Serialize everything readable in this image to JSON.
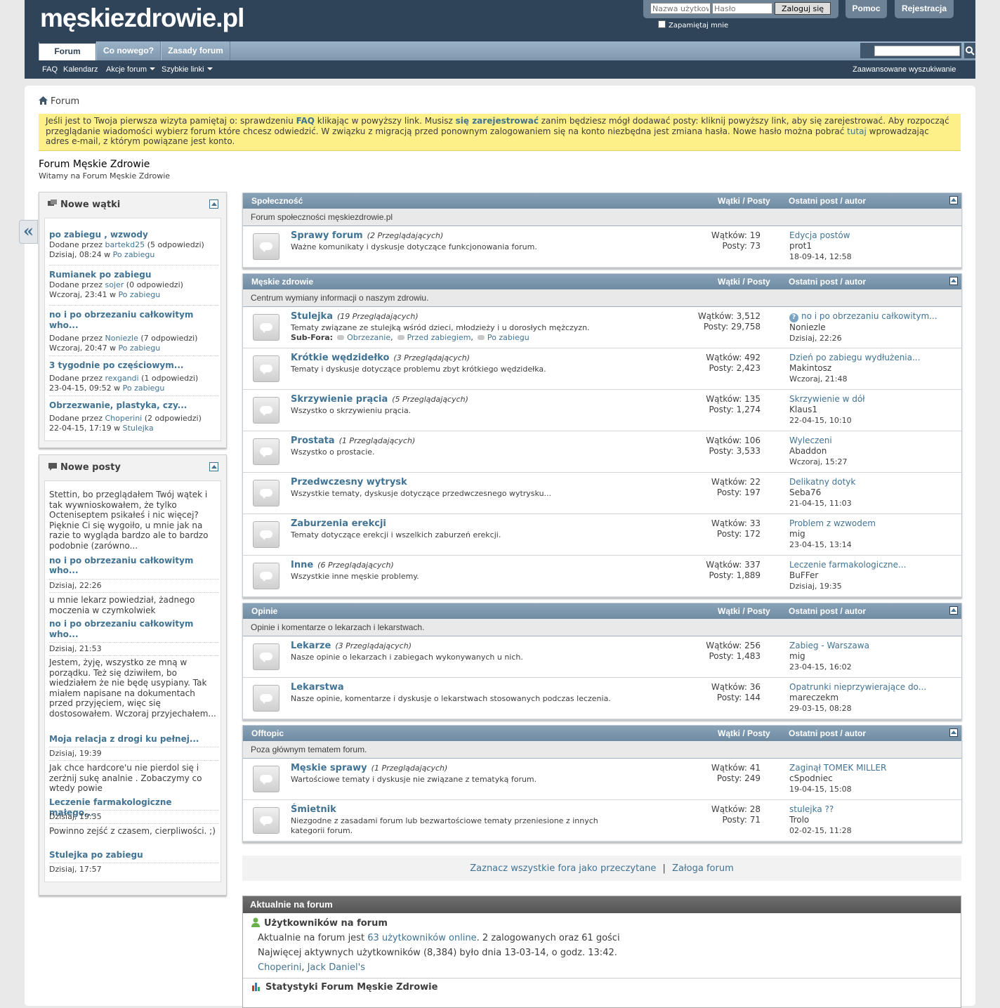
{
  "header": {
    "logo": "męskiezdrowie.pl",
    "username_placeholder": "Nazwa użytkownika",
    "password_placeholder": "Hasło",
    "login_button": "Zaloguj się",
    "remember_me": "Zapamiętaj mnie",
    "help": "Pomoc",
    "register": "Rejestracja"
  },
  "nav": {
    "tabs": [
      "Forum",
      "Co nowego?",
      "Zasady forum"
    ],
    "subnav": [
      "FAQ",
      "Kalendarz",
      "Akcje forum",
      "Szybkie linki"
    ],
    "advanced_search": "Zaawansowane wyszukiwanie"
  },
  "breadcrumb": "Forum",
  "notice": {
    "p1": "Jeśli jest to Twoja pierwsza wizyta pamiętaj o: sprawdzeniu ",
    "faq": "FAQ",
    "p2": " klikając w powyższy link. Musisz ",
    "register": "się zarejestrować",
    "p3": " zanim będziesz mógł dodawać posty: kliknij powyższy link, aby się zarejestrować. Aby rozpocząć przeglądanie wiadomości wybierz forum które chcesz odwiedzić. W związku z migracją przed ponownym zalogowaniem się na konto niezbędna jest zmiana hasła. Nowe hasło można pobrać ",
    "here": "tutaj",
    "p4": " wprowadzając adres e-mail, z którym powiązane jest konto."
  },
  "forum_title": "Forum Męskie Zdrowie",
  "forum_subtitle": "Witamy na Forum Męskie Zdrowie",
  "sidebar": {
    "new_threads_title": "Nowe wątki",
    "new_threads": [
      {
        "title": "po zabiegu , wzwody",
        "by": "Dodane przez ",
        "user": "bartekd25",
        "replies": " (5 odpowiedzi)",
        "date": "Dzisiaj, 08:24 w ",
        "forum": "Po zabiegu"
      },
      {
        "title": "Rumianek po zabiegu",
        "by": "Dodane przez ",
        "user": "sojer",
        "replies": " (0 odpowiedzi)",
        "date": "Wczoraj, 23:41 w ",
        "forum": "Po zabiegu"
      },
      {
        "title": "no i po obrzezaniu całkowitym who...",
        "by": "Dodane przez ",
        "user": "Noniezle",
        "replies": " (7 odpowiedzi)",
        "date": "Wczoraj, 20:47 w ",
        "forum": "Po zabiegu"
      },
      {
        "title": "3 tygodnie po częściowym...",
        "by": "Dodane przez ",
        "user": "rexgandi",
        "replies": " (1 odpowiedzi)",
        "date": "23-04-15, 09:52 w ",
        "forum": "Po zabiegu"
      },
      {
        "title": "Obrzezwanie, plastyka, czy...",
        "by": "Dodane przez ",
        "user": "Choperini",
        "replies": " (2 odpowiedzi)",
        "date": "22-04-15, 17:19 w ",
        "forum": "Stulejka"
      }
    ],
    "new_posts_title": "Nowe posty",
    "new_posts": [
      {
        "snippet": "Stettin, bo przeglądałem Twój wątek i tak wywnioskowałem, że tylko Octeniseptem psikałeś i nic więcej? Pięknie Ci się wygoiło, u mnie jak na razie to wygląda bardzo ale to bardzo podobnie (zarówno...",
        "title": "no i po obrzezaniu całkowitym who...",
        "date": "Dzisiaj, 22:26"
      },
      {
        "snippet": "u mnie lekarz powiedział, żadnego moczenia w czymkolwiek",
        "title": "no i po obrzezaniu całkowitym who...",
        "date": "Dzisiaj, 21:53"
      },
      {
        "snippet": "Jestem, żyję, wszystko ze mną w porządku. Też się dziwiłem, bo wiedziałem że nie będę usypiany. Tak miałem napisane na dokumentach przed przyjęciem, więc się dostosowałem. Wczoraj przyjechałem...",
        "title": "Moja relacja z drogi ku pełnej...",
        "date": "Dzisiaj, 19:39"
      },
      {
        "snippet": "Jak chce hardcore'u nie pierdol się i zerżnij sukę analnie . Zobaczymy co wtedy powie",
        "title": "Leczenie farmakologiczne małego...",
        "date": "Dzisiaj, 19:35"
      },
      {
        "snippet": "Powinno zejść z czasem, cierpliwości. ;)",
        "title": "Stulejka po zabiegu",
        "date": "Dzisiaj, 17:57"
      }
    ]
  },
  "columns": {
    "threads_posts": "Wątki / Posty",
    "last_post": "Ostatni post / autor"
  },
  "categories": [
    {
      "name": "Społeczność",
      "desc": "Forum społeczności męskiezdrowie.pl",
      "forums": [
        {
          "name": "Sprawy forum",
          "viewing": "(2 Przeglądających)",
          "desc": "Ważne komunikaty i dyskusje dotyczące funkcjonowania forum.",
          "threads": "Wątków: 19",
          "posts": "Posty: 73",
          "last_title": "Edycja postów",
          "last_user": "prot1",
          "last_date": "18-09-14, 12:58"
        }
      ]
    },
    {
      "name": "Męskie zdrowie",
      "desc": "Centrum wymiany informacji o naszym zdrowiu.",
      "forums": [
        {
          "name": "Stulejka",
          "viewing": "(19 Przeglądających)",
          "desc": "Tematy związane ze stulejką wśród dzieci, młodzieży i u dorosłych mężczyzn.",
          "subforums_label": "Sub-Fora:",
          "subforums": [
            "Obrzezanie",
            "Przed zabiegiem",
            "Po zabiegu"
          ],
          "threads": "Wątków: 3,512",
          "posts": "Posty: 29,758",
          "last_title": "no i po obrzezaniu całkowitym...",
          "last_user": "Noniezle",
          "last_date": "Dzisiaj, 22:26",
          "question_icon": true
        },
        {
          "name": "Krótkie wędzidełko",
          "viewing": "(3 Przeglądających)",
          "desc": "Tematy i dyskusje dotyczące problemu zbyt krótkiego wędzidełka.",
          "threads": "Wątków: 492",
          "posts": "Posty: 2,423",
          "last_title": "Dzień po zabiegu wydłużenia...",
          "last_user": "Makintosz",
          "last_date": "Wczoraj, 21:48"
        },
        {
          "name": "Skrzywienie prącia",
          "viewing": "(5 Przeglądających)",
          "desc": "Wszystko o skrzywieniu prącia.",
          "threads": "Wątków: 135",
          "posts": "Posty: 1,274",
          "last_title": "Skrzywienie w dół",
          "last_user": "Klaus1",
          "last_date": "22-04-15, 10:10"
        },
        {
          "name": "Prostata",
          "viewing": "(1 Przeglądających)",
          "desc": "Wszystko o prostacie.",
          "threads": "Wątków: 106",
          "posts": "Posty: 3,533",
          "last_title": "Wyleczeni",
          "last_user": "Abaddon",
          "last_date": "Wczoraj, 15:27"
        },
        {
          "name": "Przedwczesny wytrysk",
          "viewing": "",
          "desc": "Wszystkie tematy, dyskusje dotyczące przedwczesnego wytrysku...",
          "threads": "Wątków: 22",
          "posts": "Posty: 197",
          "last_title": "Delikatny dotyk",
          "last_user": "Seba76",
          "last_date": "21-04-15, 11:03"
        },
        {
          "name": "Zaburzenia erekcji",
          "viewing": "",
          "desc": "Tematy dotyczące erekcji i wszelkich zaburzeń erekcji.",
          "threads": "Wątków: 33",
          "posts": "Posty: 172",
          "last_title": "Problem z wzwodem",
          "last_user": "mig",
          "last_date": "23-04-15, 13:14"
        },
        {
          "name": "Inne",
          "viewing": "(6 Przeglądających)",
          "desc": "Wszystkie inne męskie problemy.",
          "threads": "Wątków: 337",
          "posts": "Posty: 1,889",
          "last_title": "Leczenie farmakologiczne...",
          "last_user": "BuFFer",
          "last_date": "Dzisiaj, 19:35"
        }
      ]
    },
    {
      "name": "Opinie",
      "desc": "Opinie i komentarze o lekarzach i lekarstwach.",
      "forums": [
        {
          "name": "Lekarze",
          "viewing": "(3 Przeglądających)",
          "desc": "Nasze opinie o lekarzach i zabiegach wykonywanych u nich.",
          "threads": "Wątków: 256",
          "posts": "Posty: 1,483",
          "last_title": "Zabieg - Warszawa",
          "last_user": "mig",
          "last_date": "23-04-15, 16:02"
        },
        {
          "name": "Lekarstwa",
          "viewing": "",
          "desc": "Nasze opinie, komentarze i dyskusje o lekarstwach stosowanych podczas leczenia.",
          "threads": "Wątków: 36",
          "posts": "Posty: 144",
          "last_title": "Opatrunki nieprzywierające do...",
          "last_user": "mareczekm",
          "last_date": "29-03-15, 08:28"
        }
      ]
    },
    {
      "name": "Offtopic",
      "desc": "Poza głównym tematem forum.",
      "forums": [
        {
          "name": "Męskie sprawy",
          "viewing": "(1 Przeglądających)",
          "desc": "Wartościowe tematy i dyskusje nie związane z tematyką forum.",
          "threads": "Wątków: 41",
          "posts": "Posty: 249",
          "last_title": "Zaginął TOMEK MILLER",
          "last_user": "cSpodniec",
          "last_date": "19-04-15, 15:08"
        },
        {
          "name": "Śmietnik",
          "viewing": "",
          "desc": "Niezgodne z zasadami forum lub bezwartościowe tematy przeniesione z innych kategorii forum.",
          "threads": "Wątków: 28",
          "posts": "Posty: 71",
          "last_title": "stulejka ??",
          "last_user": "Trolo",
          "last_date": "02-02-15, 11:28"
        }
      ]
    }
  ],
  "footer_links": {
    "mark_read": "Zaznacz wszystkie fora jako przeczytane",
    "sep": "|",
    "staff": "Załoga forum"
  },
  "whats_going_on": {
    "title": "Aktualnie na forum",
    "users_title": "Użytkowników na forum",
    "online_pre": "Aktualnie na forum jest ",
    "online_link": "63 użytkowników online",
    "online_post": ". 2 zalogowanych oraz 61 gości",
    "most": "Najwięcej aktywnych użytkowników (8,384) było dnia 13-03-14, o godz. 13:42.",
    "users": [
      "Choperini",
      "Jack Daniel's"
    ],
    "stats_title": "Statystyki Forum Męskie Zdrowie"
  }
}
